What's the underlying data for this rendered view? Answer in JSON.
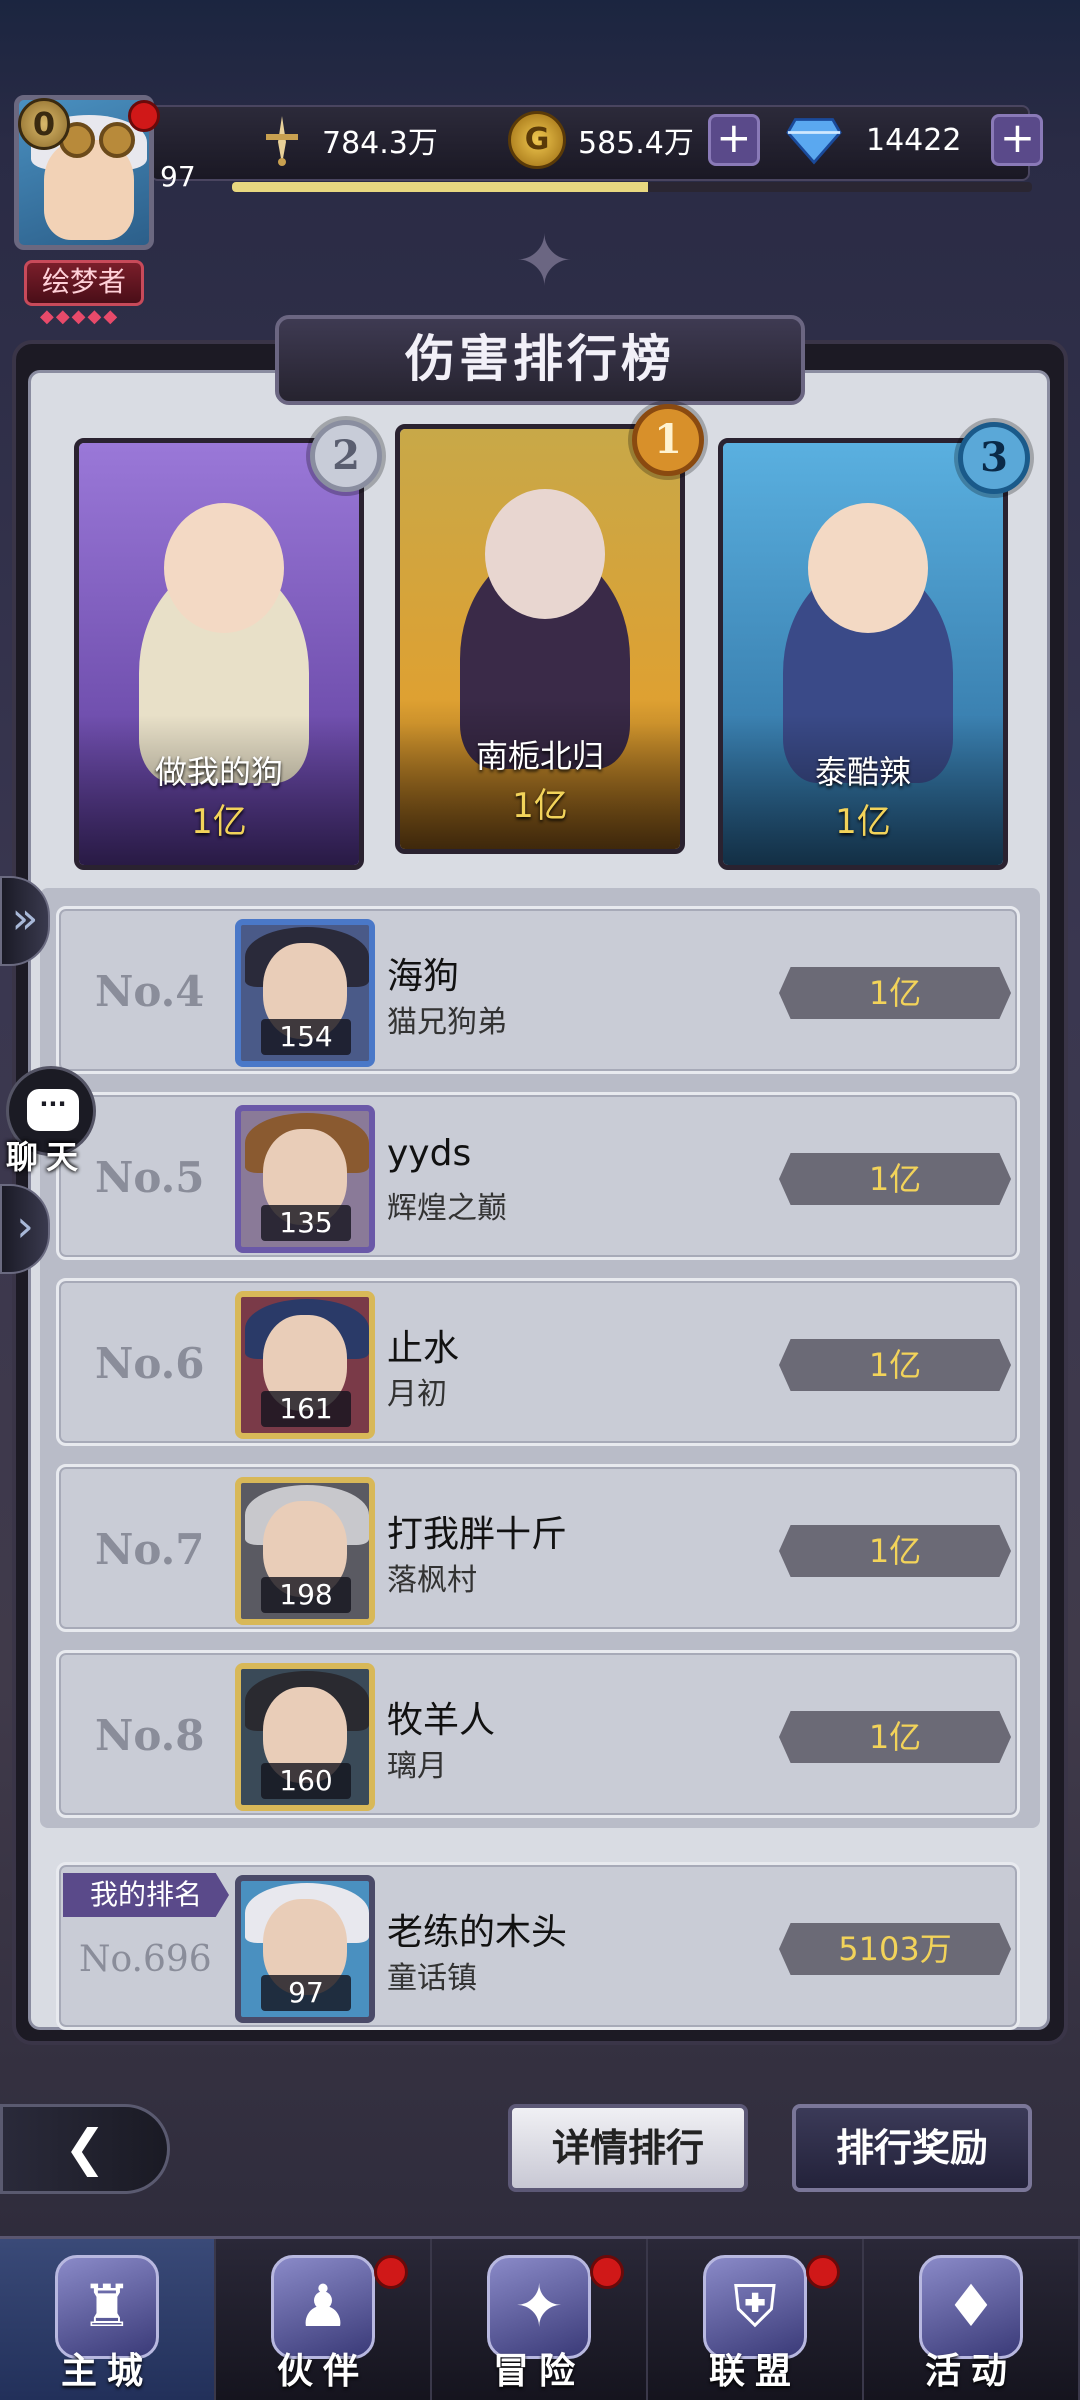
{
  "hud": {
    "vip_level": "0",
    "player_level": "97",
    "title": "绘梦者",
    "title_stars": "◆◆◆◆◆",
    "xp_progress": 0.52,
    "resources": [
      {
        "name": "power",
        "icon": "sword-icon",
        "value": "784.3万"
      },
      {
        "name": "gold",
        "icon": "coin-icon",
        "value": "585.4万"
      },
      {
        "name": "diamond",
        "icon": "diamond-icon",
        "value": "14422"
      }
    ]
  },
  "panel": {
    "title": "伤害排行榜"
  },
  "top3": [
    {
      "rank": "2",
      "name": "做我的狗",
      "value": "1亿",
      "theme": "#7a58b8",
      "medal_color": "#c8ccd8"
    },
    {
      "rank": "1",
      "name": "南栀北归",
      "value": "1亿",
      "theme": "#b89a38",
      "medal_color": "#d8902a"
    },
    {
      "rank": "3",
      "name": "泰酷辣",
      "value": "1亿",
      "theme": "#3a88b8",
      "medal_color": "#5aa8d8"
    }
  ],
  "ranks": [
    {
      "no": "No.4",
      "name": "海狗",
      "guild": "猫兄狗弟",
      "level": "154",
      "value": "1亿",
      "frame": "#4a78c8"
    },
    {
      "no": "No.5",
      "name": "yyds",
      "guild": "辉煌之巅",
      "level": "135",
      "value": "1亿",
      "frame": "#6a58a8"
    },
    {
      "no": "No.6",
      "name": "止水",
      "guild": "月初",
      "level": "161",
      "value": "1亿",
      "frame": "#d8b858"
    },
    {
      "no": "No.7",
      "name": "打我胖十斤",
      "guild": "落枫村",
      "level": "198",
      "value": "1亿",
      "frame": "#d8b858"
    },
    {
      "no": "No.8",
      "name": "牧羊人",
      "guild": "璃月",
      "level": "160",
      "value": "1亿",
      "frame": "#d8b858"
    }
  ],
  "my_rank": {
    "tag": "我的排名",
    "no": "No.696",
    "name": "老练的木头",
    "guild": "童话镇",
    "level": "97",
    "value": "5103万"
  },
  "side": {
    "chat_label": "聊天"
  },
  "buttons": {
    "back": "back-arrow-icon",
    "detail": "详情排行",
    "reward": "排行奖励"
  },
  "nav": [
    {
      "label": "主城",
      "active": true,
      "dot": false
    },
    {
      "label": "伙伴",
      "active": false,
      "dot": true
    },
    {
      "label": "冒险",
      "active": false,
      "dot": true
    },
    {
      "label": "联盟",
      "active": false,
      "dot": true
    },
    {
      "label": "活动",
      "active": false,
      "dot": false
    }
  ]
}
